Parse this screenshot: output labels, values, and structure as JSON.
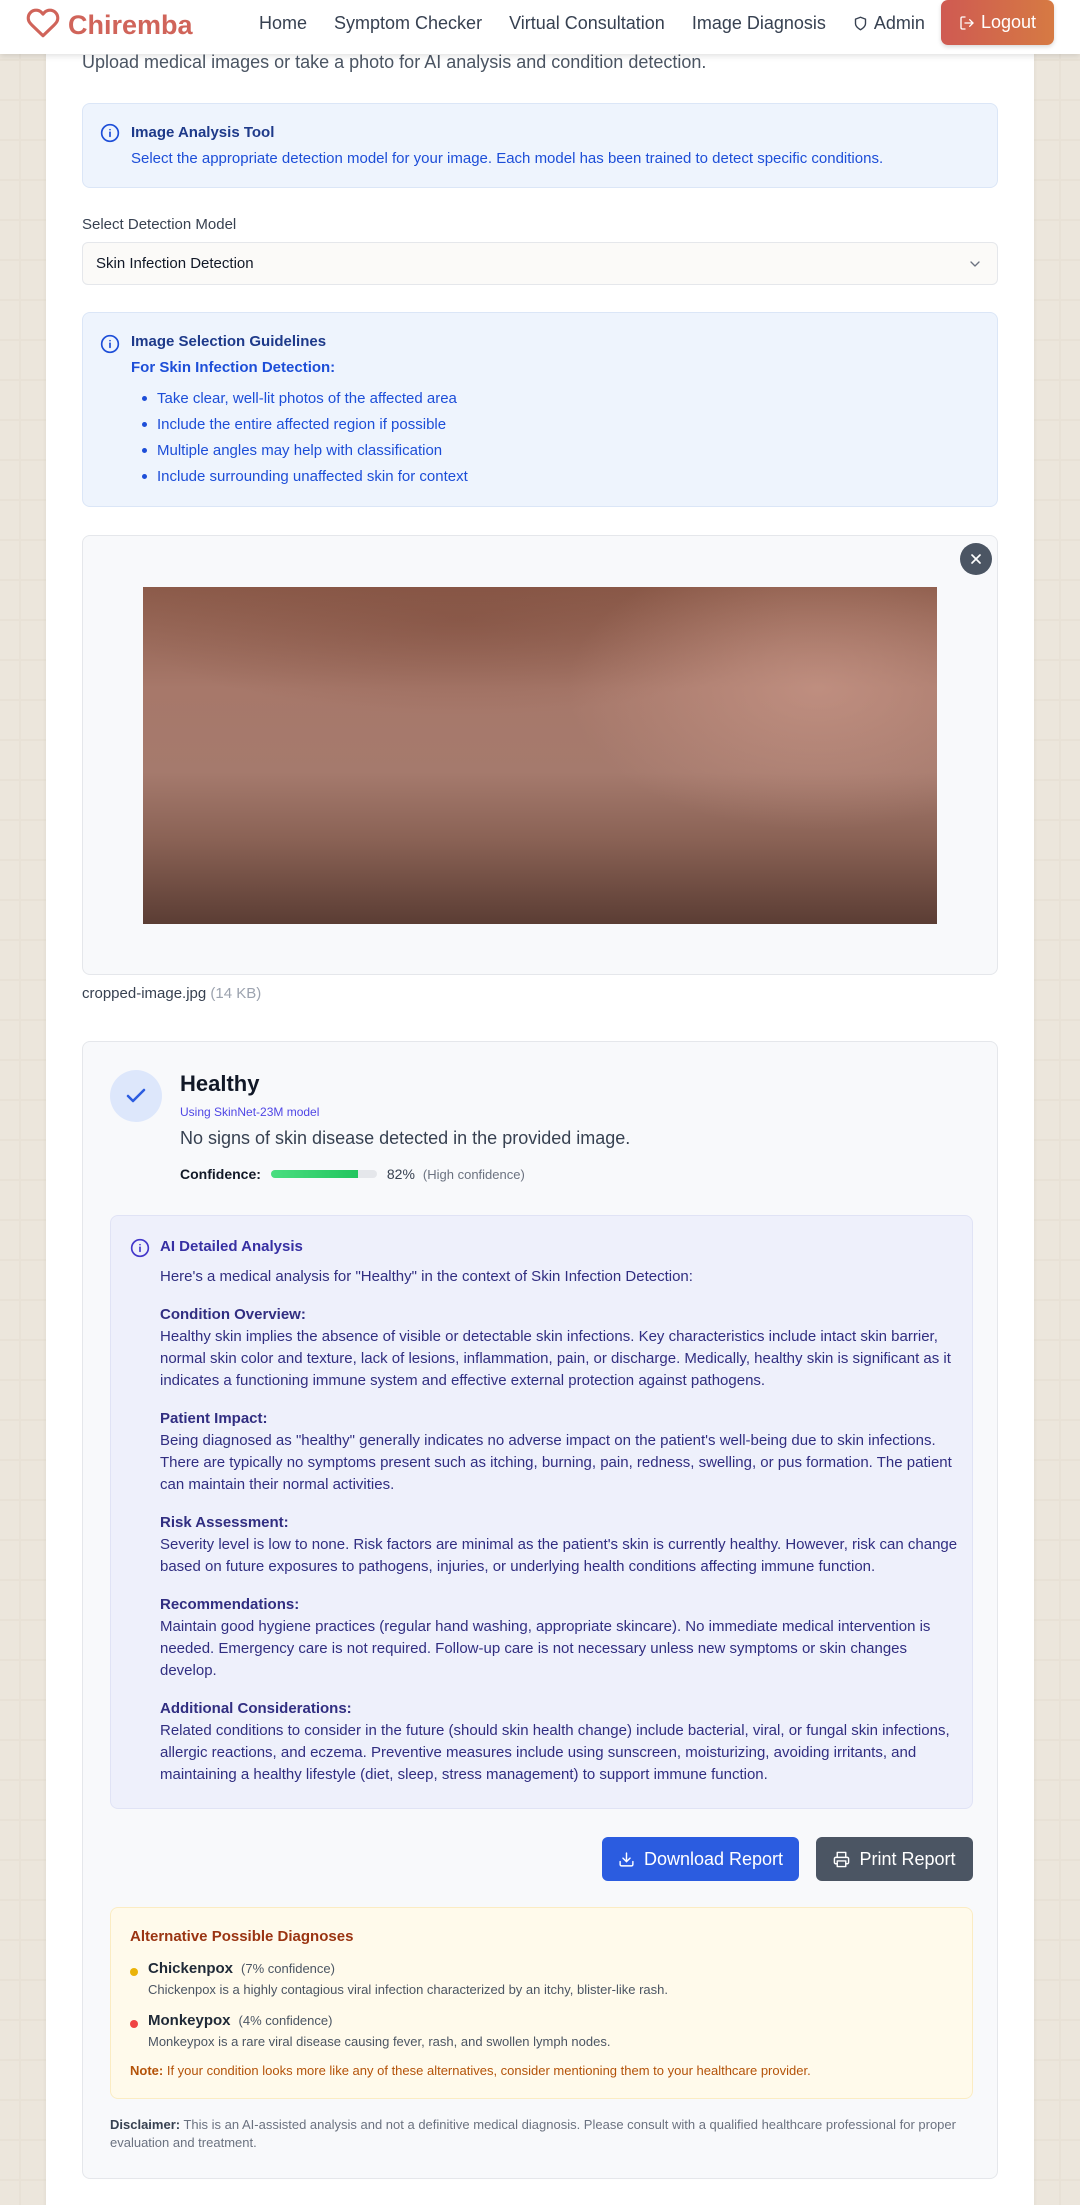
{
  "nav": {
    "brand": "Chiremba",
    "links": [
      "Home",
      "Symptom Checker",
      "Virtual Consultation",
      "Image Diagnosis"
    ],
    "admin": "Admin",
    "logout": "Logout",
    "brand_color": "#d0645a"
  },
  "page": {
    "subtitle": "Upload medical images or take a photo for AI analysis and condition detection."
  },
  "tool_info": {
    "title": "Image Analysis Tool",
    "text": "Select the appropriate detection model for your image. Each model has been trained to detect specific conditions."
  },
  "model_select": {
    "label": "Select Detection Model",
    "value": "Skin Infection Detection"
  },
  "guidelines": {
    "title": "Image Selection Guidelines",
    "subtitle": "For Skin Infection Detection:",
    "items": [
      "Take clear, well-lit photos of the affected area",
      "Include the entire affected region if possible",
      "Multiple angles may help with classification",
      "Include surrounding unaffected skin for context"
    ]
  },
  "upload": {
    "filename": "cropped-image.jpg",
    "filesize": "(14 KB)"
  },
  "result": {
    "title": "Healthy",
    "model": "Using SkinNet-23M model",
    "description": "No signs of skin disease detected in the provided image.",
    "confidence_label": "Confidence:",
    "confidence_value": "82%",
    "confidence_fraction": 0.82,
    "confidence_note": "(High confidence)"
  },
  "analysis": {
    "title": "AI Detailed Analysis",
    "intro": "Here's a medical analysis for \"Healthy\" in the context of Skin Infection Detection:",
    "sections": [
      {
        "heading": "Condition Overview:",
        "text": "Healthy skin implies the absence of visible or detectable skin infections. Key characteristics include intact skin barrier, normal skin color and texture, lack of lesions, inflammation, pain, or discharge. Medically, healthy skin is significant as it indicates a functioning immune system and effective external protection against pathogens."
      },
      {
        "heading": "Patient Impact:",
        "text": "Being diagnosed as \"healthy\" generally indicates no adverse impact on the patient's well-being due to skin infections. There are typically no symptoms present such as itching, burning, pain, redness, swelling, or pus formation. The patient can maintain their normal activities."
      },
      {
        "heading": "Risk Assessment:",
        "text": "Severity level is low to none. Risk factors are minimal as the patient's skin is currently healthy. However, risk can change based on future exposures to pathogens, injuries, or underlying health conditions affecting immune function."
      },
      {
        "heading": "Recommendations:",
        "text": "Maintain good hygiene practices (regular hand washing, appropriate skincare). No immediate medical intervention is needed. Emergency care is not required. Follow-up care is not necessary unless new symptoms or skin changes develop."
      },
      {
        "heading": "Additional Considerations:",
        "text": "Related conditions to consider in the future (should skin health change) include bacterial, viral, or fungal skin infections, allergic reactions, and eczema. Preventive measures include using sunscreen, moisturizing, avoiding irritants, and maintaining a healthy lifestyle (diet, sleep, stress management) to support immune function."
      }
    ]
  },
  "actions": {
    "download": "Download Report",
    "print": "Print Report"
  },
  "alternatives": {
    "title": "Alternative Possible Diagnoses",
    "items": [
      {
        "name": "Chickenpox",
        "confidence": "(7% confidence)",
        "description": "Chickenpox is a highly contagious viral infection characterized by an itchy, blister-like rash.",
        "color": "#eab308"
      },
      {
        "name": "Monkeypox",
        "confidence": "(4% confidence)",
        "description": "Monkeypox is a rare viral disease causing fever, rash, and swollen lymph nodes.",
        "color": "#ef4444"
      }
    ],
    "note_label": "Note:",
    "note_text": "If your condition looks more like any of these alternatives, consider mentioning them to your healthcare provider."
  },
  "disclaimer": {
    "label": "Disclaimer:",
    "text": "This is an AI-assisted analysis and not a definitive medical diagnosis. Please consult with a qualified healthcare professional for proper evaluation and treatment."
  }
}
